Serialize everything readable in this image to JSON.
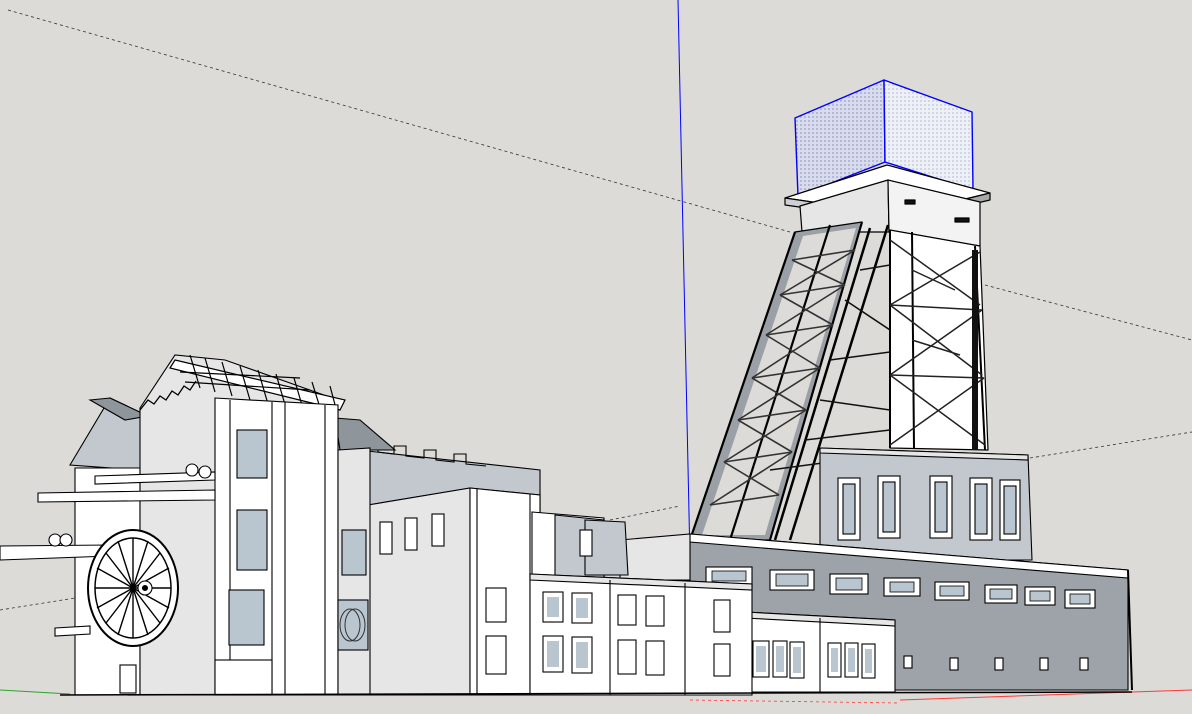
{
  "app": {
    "view": "3d-modeling-viewport"
  },
  "scene": {
    "description_items": [
      "mine-headframe-tower",
      "winding-house",
      "industrial-buildings",
      "spoked-winding-wheel"
    ],
    "colors": {
      "background": "#dcdbd7",
      "face_light": "#ffffff",
      "face_mid": "#e6e6e6",
      "face_shadow": "#c2c8ce",
      "face_dark": "#8e959b",
      "window_glass": "#b9c6d0",
      "edge": "#000000",
      "axis_blue": "#0000ff",
      "axis_red": "#ff0000",
      "axis_green": "#00aa00",
      "selection": "#0000ff"
    }
  }
}
